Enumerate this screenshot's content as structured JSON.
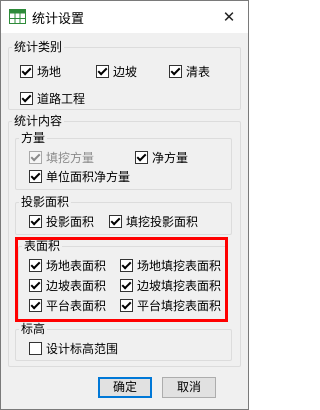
{
  "window": {
    "title": "统计设置",
    "close_glyph": "✕"
  },
  "category_group": {
    "legend": "统计类别",
    "items": [
      {
        "label": "场地",
        "checked": true
      },
      {
        "label": "边坡",
        "checked": true
      },
      {
        "label": "清表",
        "checked": true
      },
      {
        "label": "道路工程",
        "checked": true
      }
    ]
  },
  "content_group": {
    "legend": "统计内容",
    "volume": {
      "legend": "方量",
      "items": [
        {
          "label": "填挖方量",
          "checked": true,
          "disabled": true
        },
        {
          "label": "净方量",
          "checked": true
        },
        {
          "label": "单位面积净方量",
          "checked": true
        }
      ]
    },
    "projected_area": {
      "legend": "投影面积",
      "items": [
        {
          "label": "投影面积",
          "checked": true
        },
        {
          "label": "填挖投影面积",
          "checked": true
        }
      ]
    },
    "surface_area": {
      "legend": "表面积",
      "items": [
        {
          "label": "场地表面积",
          "checked": true
        },
        {
          "label": "场地填挖表面积",
          "checked": true
        },
        {
          "label": "边坡表面积",
          "checked": true
        },
        {
          "label": "边坡填挖表面积",
          "checked": true
        },
        {
          "label": "平台表面积",
          "checked": true
        },
        {
          "label": "平台填挖表面积",
          "checked": true
        }
      ]
    },
    "elevation": {
      "legend": "标高",
      "items": [
        {
          "label": "设计标高范围",
          "checked": false
        }
      ]
    }
  },
  "buttons": {
    "ok": "确定",
    "cancel": "取消"
  },
  "colors": {
    "highlight": "#ff0000",
    "app_icon": "#2e8b3a",
    "default_button_border": "#0078d7"
  },
  "icons": {
    "app": "spreadsheet-app-icon",
    "close": "close-icon"
  }
}
